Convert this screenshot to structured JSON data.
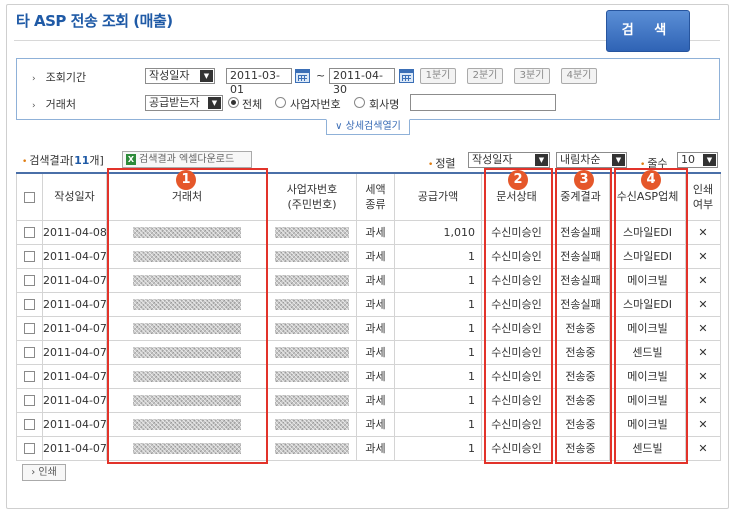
{
  "page": {
    "title": "타 ASP 전송 조회 (매출)"
  },
  "search": {
    "period_label": "조회기간",
    "period_type": "작성일자",
    "date_from": "2011-03-01",
    "tilde": "~",
    "date_to": "2011-04-30",
    "quarters": [
      "1분기",
      "2분기",
      "3분기",
      "4분기"
    ],
    "partner_label": "거래처",
    "partner_type": "공급받는자",
    "radio_all": "전체",
    "radio_biz": "사업자번호",
    "radio_company": "회사명",
    "search_button": "검 색",
    "detail_toggle": "∨ 상세검색열기"
  },
  "results": {
    "prefix": "검색결과[",
    "count": "11",
    "suffix": "개]",
    "excel_button": "검색결과 엑셀다운로드",
    "sort_label": "정렬",
    "sort_field": "작성일자",
    "sort_order": "내림차순",
    "rows_label": "줄수",
    "rows_value": "10"
  },
  "table": {
    "headers": {
      "date": "작성일자",
      "partner": "거래처",
      "biz_no_1": "사업자번호",
      "biz_no_2": "(주민번호)",
      "tax_1": "세액",
      "tax_2": "종류",
      "amount": "공급가액",
      "doc_status": "문서상태",
      "relay_result": "중계결과",
      "recv_asp": "수신ASP업체",
      "print_1": "인쇄",
      "print_2": "여부"
    },
    "rows": [
      {
        "date": "2011-04-08",
        "tax": "과세",
        "amount": "1,010",
        "status": "수신미승인",
        "relay": "전송실패",
        "asp": "스마일EDI",
        "print": "✕"
      },
      {
        "date": "2011-04-07",
        "tax": "과세",
        "amount": "1",
        "status": "수신미승인",
        "relay": "전송실패",
        "asp": "스마일EDI",
        "print": "✕"
      },
      {
        "date": "2011-04-07",
        "tax": "과세",
        "amount": "1",
        "status": "수신미승인",
        "relay": "전송실패",
        "asp": "메이크빌",
        "print": "✕"
      },
      {
        "date": "2011-04-07",
        "tax": "과세",
        "amount": "1",
        "status": "수신미승인",
        "relay": "전송실패",
        "asp": "스마일EDI",
        "print": "✕"
      },
      {
        "date": "2011-04-07",
        "tax": "과세",
        "amount": "1",
        "status": "수신미승인",
        "relay": "전송중",
        "asp": "메이크빌",
        "print": "✕"
      },
      {
        "date": "2011-04-07",
        "tax": "과세",
        "amount": "1",
        "status": "수신미승인",
        "relay": "전송중",
        "asp": "센드빌",
        "print": "✕"
      },
      {
        "date": "2011-04-07",
        "tax": "과세",
        "amount": "1",
        "status": "수신미승인",
        "relay": "전송중",
        "asp": "메이크빌",
        "print": "✕"
      },
      {
        "date": "2011-04-07",
        "tax": "과세",
        "amount": "1",
        "status": "수신미승인",
        "relay": "전송중",
        "asp": "메이크빌",
        "print": "✕"
      },
      {
        "date": "2011-04-07",
        "tax": "과세",
        "amount": "1",
        "status": "수신미승인",
        "relay": "전송중",
        "asp": "메이크빌",
        "print": "✕"
      },
      {
        "date": "2011-04-07",
        "tax": "과세",
        "amount": "1",
        "status": "수신미승인",
        "relay": "전송중",
        "asp": "센드빌",
        "print": "✕"
      }
    ]
  },
  "badges": [
    "1",
    "2",
    "3",
    "4"
  ],
  "footer": {
    "print_button": "› 인쇄"
  },
  "colors": {
    "accent": "#1f5aa6",
    "highlight": "#e2332a",
    "badge": "#e5572a"
  }
}
